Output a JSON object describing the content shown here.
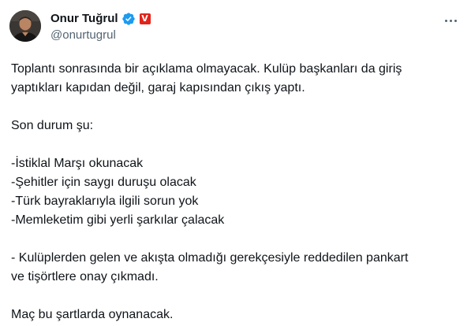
{
  "author": {
    "display_name": "Onur Tuğrul",
    "handle": "@onurtugrul",
    "verified": true,
    "affiliate_badge": "V",
    "avatar_icon": "person-avatar-icon"
  },
  "menu": {
    "icon": "more-horizontal-icon"
  },
  "tweet": {
    "paragraphs": [
      [
        "Toplantı sonrasında bir açıklama olmayacak. Kulüp başkanları da giriş",
        "yaptıkları kapıdan değil, garaj kapısından çıkış yaptı."
      ],
      [
        "Son durum şu:"
      ],
      [
        "-İstiklal Marşı okunacak",
        "-Şehitler için saygı duruşu olacak",
        "-Türk bayraklarıyla ilgili sorun yok",
        "-Memleketim gibi yerli şarkılar çalacak"
      ],
      [
        "- Kulüplerden gelen ve akışta olmadığı gerekçesiyle reddedilen pankart",
        "ve tişörtlere onay çıkmadı."
      ],
      [
        "Maç bu şartlarda oynanacak."
      ]
    ]
  },
  "colors": {
    "text": "#0f1419",
    "secondary": "#536471",
    "verified_blue": "#1d9bf0",
    "badge_red": "#e2231a"
  }
}
